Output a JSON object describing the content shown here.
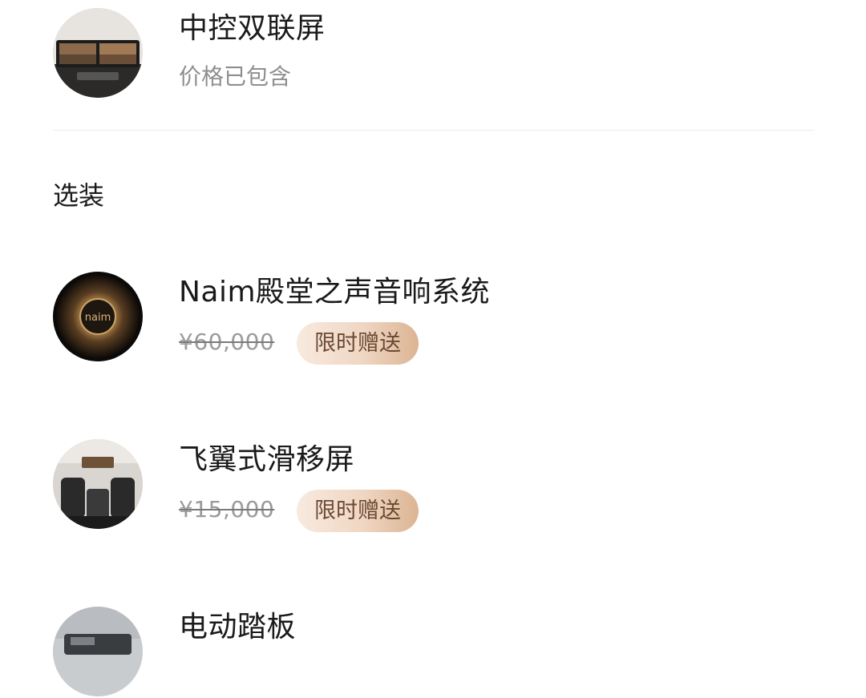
{
  "included_item": {
    "title": "中控双联屏",
    "subtitle": "价格已包含",
    "image": "dual-center-screen-image"
  },
  "section": {
    "label": "选装"
  },
  "options": [
    {
      "title": "Naim殿堂之声音响系统",
      "price": "¥60,000",
      "badge": "限时赠送",
      "image": "naim-speaker-image"
    },
    {
      "title": "飞翼式滑移屏",
      "price": "¥15,000",
      "badge": "限时赠送",
      "image": "car-interior-screen-image"
    },
    {
      "title": "电动踏板",
      "image": "car-exterior-image"
    }
  ],
  "colors": {
    "badge_gradient_start": "#f8eadf",
    "badge_gradient_end": "#dcb493",
    "badge_text": "#6b4a35",
    "muted_text": "#8e8e8e"
  }
}
